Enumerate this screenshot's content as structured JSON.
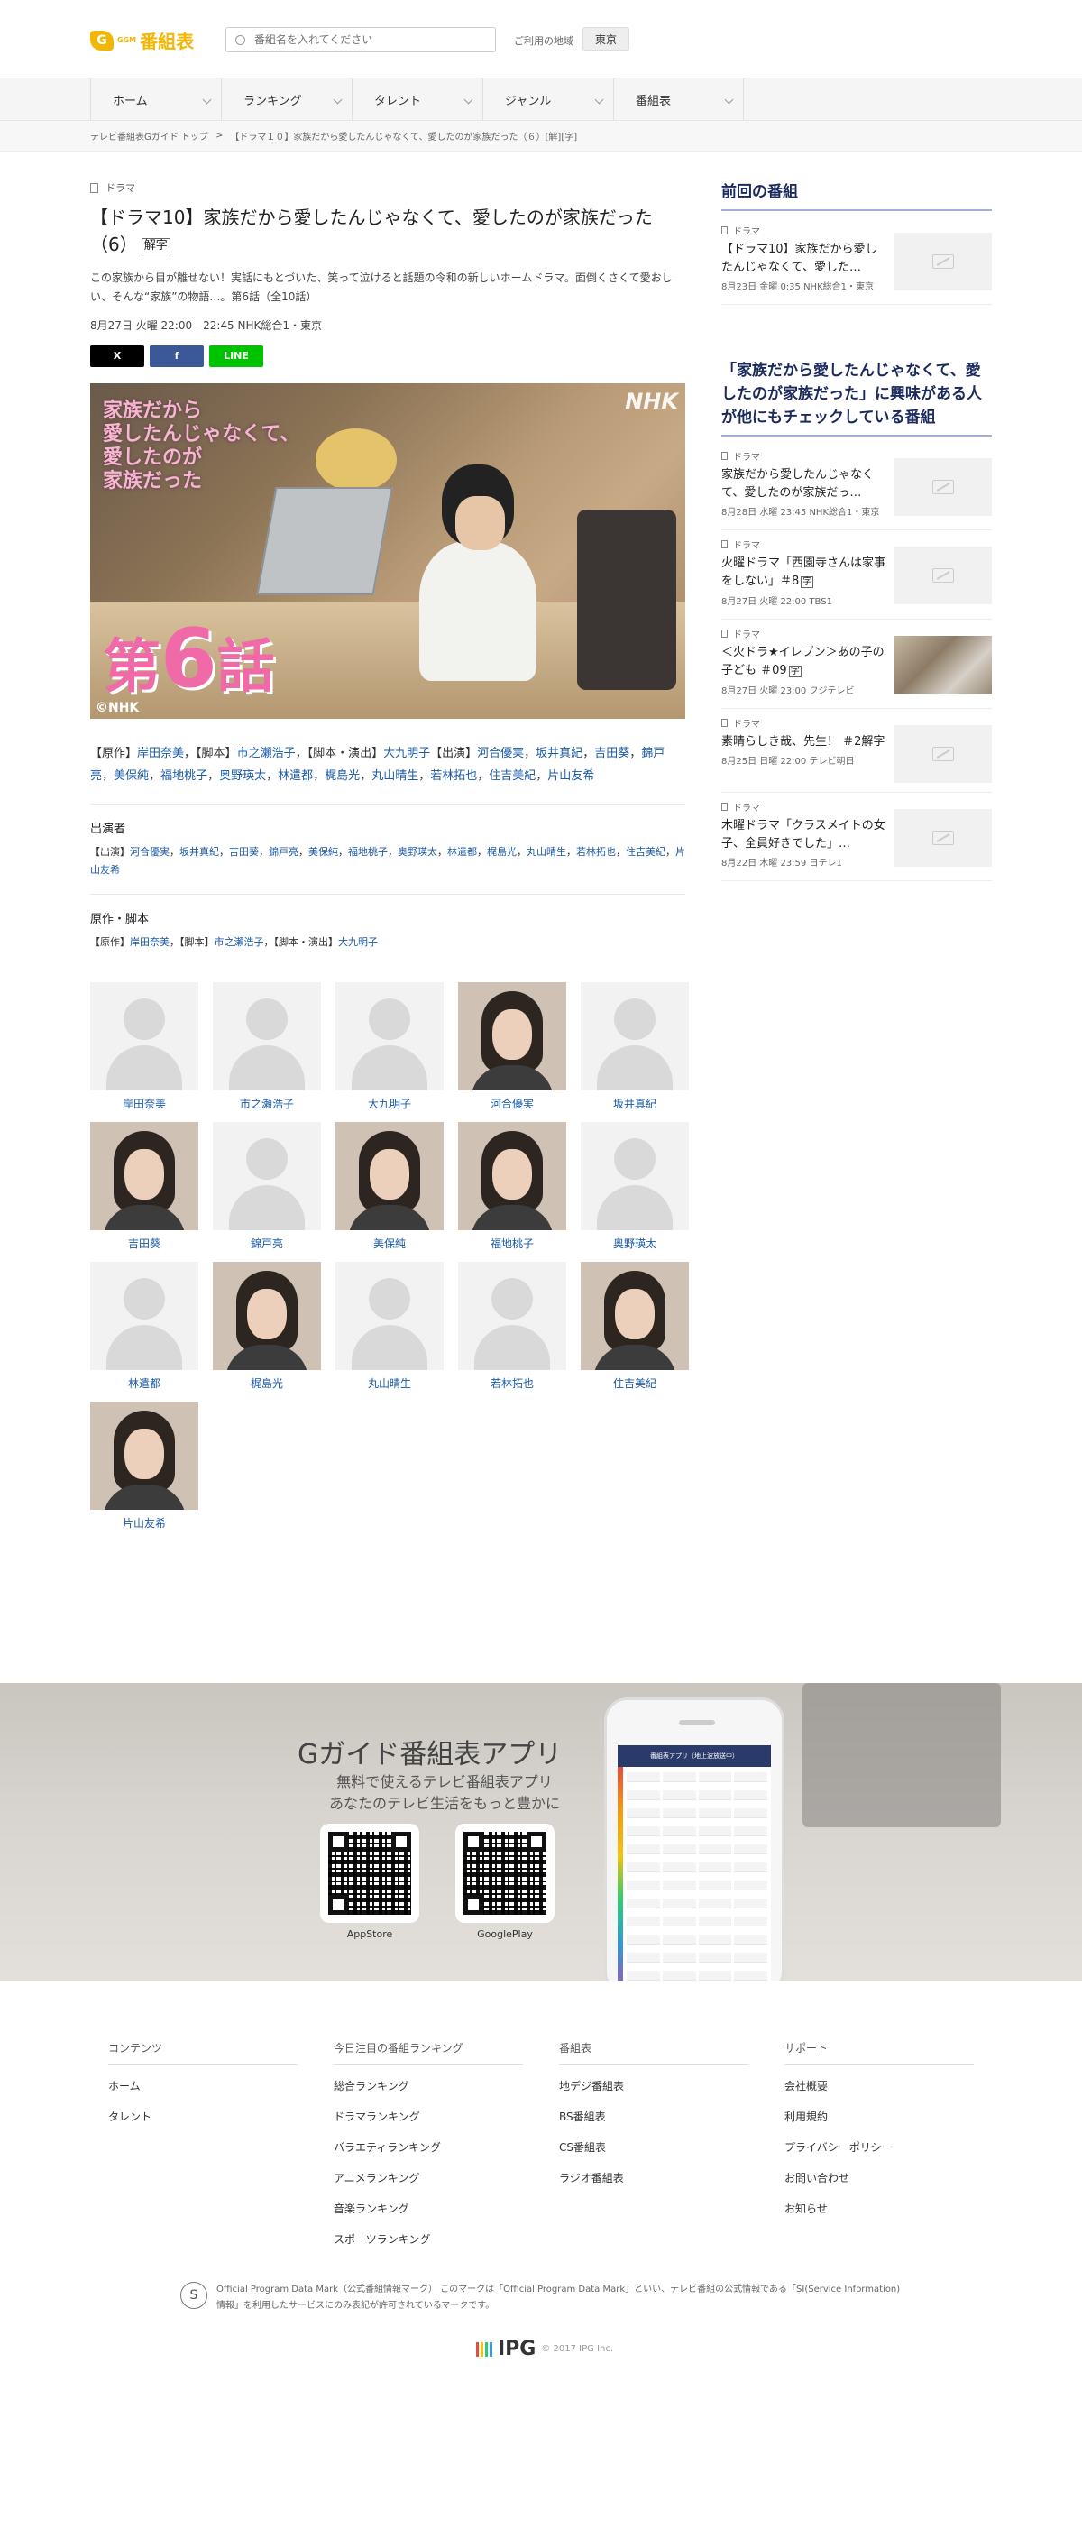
{
  "header": {
    "logo_mark": "G",
    "logo_sub": "GGM",
    "logo_text": "番組表",
    "search_placeholder": "番組名を入れてください",
    "region_label": "ご利用の地域",
    "region_value": "東京"
  },
  "nav": [
    {
      "label": "ホーム"
    },
    {
      "label": "ランキング"
    },
    {
      "label": "タレント"
    },
    {
      "label": "ジャンル"
    },
    {
      "label": "番組表"
    }
  ],
  "breadcrumb": {
    "home": "テレビ番組表Gガイド トップ",
    "sep": ">",
    "current": "【ドラマ１０】家族だから愛したんじゃなくて、愛したのが家族だった（６）[解][字]"
  },
  "program": {
    "genre": "ドラマ",
    "title": "【ドラマ10】家族だから愛したんじゃなくて、愛したのが家族だった（6）",
    "badge": "解字",
    "description": "この家族から目が離せない！実話にもとづいた、笑って泣けると話題の令和の新しいホームドラマ。面倒くさくて愛おしい、そんな“家族”の物語…。第6話（全10話）",
    "airtime": "8月27日 火曜 22:00 - 22:45 NHK総合1・東京",
    "share": {
      "x": "X",
      "facebook": "f",
      "line": "LINE"
    },
    "hero": {
      "caption_lines": [
        "家族だから",
        "愛したんじゃなくて、",
        "愛したのが",
        "家族だった"
      ],
      "network": "NHK",
      "ep_prefix": "第",
      "ep_num": "6",
      "ep_suffix": "話",
      "copyright": "©NHK"
    },
    "credits": {
      "original_label": "【原作】",
      "original": "岸田奈美",
      "script_label": "【脚本】",
      "script": "市之瀬浩子",
      "script_director_label": "【脚本・演出】",
      "script_director": "大九明子",
      "cast_label": "【出演】",
      "cast": [
        "河合優実",
        "坂井真紀",
        "吉田葵",
        "錦戸亮",
        "美保純",
        "福地桃子",
        "奥野瑛太",
        "林遣都",
        "梶島光",
        "丸山晴生",
        "若林拓也",
        "住吉美紀",
        "片山友希"
      ]
    },
    "performers_heading": "出演者",
    "staff_heading": "原作・脚本"
  },
  "cast_cards": [
    {
      "name": "岸田奈美",
      "photo": false
    },
    {
      "name": "市之瀬浩子",
      "photo": false
    },
    {
      "name": "大九明子",
      "photo": false
    },
    {
      "name": "河合優実",
      "photo": true
    },
    {
      "name": "坂井真紀",
      "photo": false
    },
    {
      "name": "吉田葵",
      "photo": true
    },
    {
      "name": "錦戸亮",
      "photo": false
    },
    {
      "name": "美保純",
      "photo": true
    },
    {
      "name": "福地桃子",
      "photo": true
    },
    {
      "name": "奥野瑛太",
      "photo": false
    },
    {
      "name": "林遣都",
      "photo": false
    },
    {
      "name": "梶島光",
      "photo": true
    },
    {
      "name": "丸山晴生",
      "photo": false
    },
    {
      "name": "若林拓也",
      "photo": false
    },
    {
      "name": "住吉美紀",
      "photo": true
    },
    {
      "name": "片山友希",
      "photo": true
    }
  ],
  "sidebar": {
    "previous_heading": "前回の番組",
    "previous": [
      {
        "genre": "ドラマ",
        "title": "【ドラマ10】家族だから愛したんじゃなくて、愛した…",
        "meta": "8月23日 金曜 0:35 NHK総合1・東京",
        "photo": false,
        "badge": ""
      }
    ],
    "related_heading": "「家族だから愛したんじゃなくて、愛したのが家族だった」に興味がある人が他にもチェックしている番組",
    "related": [
      {
        "genre": "ドラマ",
        "title": "家族だから愛したんじゃなくて、愛したのが家族だっ…",
        "meta": "8月28日 水曜 23:45 NHK総合1・東京",
        "photo": false,
        "badge": ""
      },
      {
        "genre": "ドラマ",
        "title": "火曜ドラマ「西園寺さんは家事をしない」＃8",
        "meta": "8月27日 火曜 22:00 TBS1",
        "photo": false,
        "badge": "字"
      },
      {
        "genre": "ドラマ",
        "title": "＜火ドラ★イレブン＞あの子の子ども ＃09",
        "meta": "8月27日 火曜 23:00 フジテレビ",
        "photo": true,
        "badge": "字"
      },
      {
        "genre": "ドラマ",
        "title": "素晴らしき哉、先生！ ＃2解字",
        "meta": "8月25日 日曜 22:00 テレビ朝日",
        "photo": false,
        "badge": ""
      },
      {
        "genre": "ドラマ",
        "title": "木曜ドラマ「クラスメイトの女子、全員好きでした」…",
        "meta": "8月22日 木曜 23:59 日テレ1",
        "photo": false,
        "badge": ""
      }
    ]
  },
  "app_banner": {
    "title": "Gガイド番組表アプリ",
    "sub1": "無料で使えるテレビ番組表アプリ",
    "sub2": "あなたのテレビ生活をもっと豊かに",
    "appstore": "AppStore",
    "googleplay": "GooglePlay",
    "phone_bar": "番組表アプリ（地上波放送中）"
  },
  "footer": {
    "columns": [
      {
        "heading": "コンテンツ",
        "links": [
          "ホーム",
          "タレント"
        ]
      },
      {
        "heading": "今日注目の番組ランキング",
        "links": [
          "総合ランキング",
          "ドラマランキング",
          "バラエティランキング",
          "アニメランキング",
          "音楽ランキング",
          "スポーツランキング"
        ]
      },
      {
        "heading": "番組表",
        "links": [
          "地デジ番組表",
          "BS番組表",
          "CS番組表",
          "ラジオ番組表"
        ]
      },
      {
        "heading": "サポート",
        "links": [
          "会社概要",
          "利用規約",
          "プライバシーポリシー",
          "お問い合わせ",
          "お知らせ"
        ]
      }
    ],
    "opdm_icon": "S",
    "opdm_text": "Official Program Data Mark（公式番組情報マーク） このマークは「Official Program Data Mark」といい、テレビ番組の公式情報である「SI(Service Information)情報」を利用したサービスにのみ表記が許可されているマークです。",
    "ipg_logo": "IPG",
    "ipg_copy": "© 2017 IPG Inc."
  },
  "colors": {
    "brand_yellow": "#f2b705",
    "link_blue": "#1a5aa6",
    "sidebar_heading": "#1b2a5c",
    "episode_pink": "#f06aa8"
  }
}
